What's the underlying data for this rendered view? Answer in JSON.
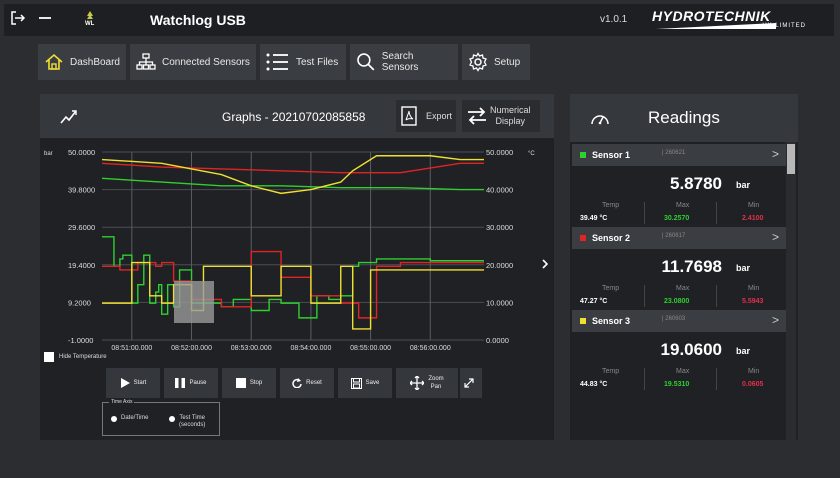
{
  "app": {
    "title": "Watchlog USB",
    "version": "v1.0.1",
    "brand": "HYDROTECHNIK",
    "brand_sub": "UK LIMITED",
    "logo_text": "WL"
  },
  "nav": [
    {
      "label": "DashBoard",
      "icon": "home-icon"
    },
    {
      "label": "Connected Sensors",
      "icon": "network-icon"
    },
    {
      "label": "Test Files",
      "icon": "list-icon"
    },
    {
      "label": "Search Sensors",
      "icon": "search-icon"
    },
    {
      "label": "Setup",
      "icon": "gear-icon"
    }
  ],
  "graph": {
    "title": "Graphs - 20210702085858",
    "export_label": "Export",
    "numerical_label_1": "Numerical",
    "numerical_label_2": "Display",
    "hide_temperature_label": "Hide Temperature",
    "left_unit": "bar",
    "right_unit": "°C",
    "controls": {
      "start": "Start",
      "pause": "Pause",
      "stop": "Stop",
      "reset": "Reset",
      "save": "Save",
      "zoom_1": "Zoom",
      "zoom_2": "Pan"
    },
    "time_axis": {
      "title": "Time Axis",
      "option1": "Date/Time",
      "option2_1": "Test Time",
      "option2_2": "(seconds)"
    }
  },
  "chart_data": {
    "type": "line",
    "ylabel": "bar",
    "y2label": "°C",
    "ylim": [
      -1.0,
      50.0
    ],
    "y2lim": [
      0,
      50
    ],
    "yticks": [
      "50.0000",
      "39.8000",
      "29.6000",
      "19.4000",
      "9.2000",
      "-1.0000"
    ],
    "y2ticks": [
      "50.0000",
      "40.0000",
      "30.0000",
      "20.0000",
      "10.0000",
      "0.0000"
    ],
    "xticks": [
      "08:51:00.000",
      "08:52:00.000",
      "08:53:00.000",
      "08:54:00.000",
      "08:55:00.000",
      "08:56:00.000"
    ],
    "grid": true,
    "series": [
      {
        "name": "Sensor 1",
        "color": "#2fd02f",
        "axis": "pressure",
        "x": [
          0,
          0.2,
          0.3,
          0.35,
          0.5,
          0.6,
          0.7,
          0.8,
          0.9,
          0.95,
          1.0,
          1.1,
          1.2,
          1.3,
          1.5,
          2.0,
          2.2,
          2.5,
          2.8,
          3.0,
          3.3,
          3.6,
          3.8,
          4.0,
          4.2,
          4.3,
          4.6,
          5.0,
          5.5,
          6.0,
          6.4
        ],
        "values": [
          27,
          19,
          21,
          22,
          9,
          14,
          22,
          9,
          12,
          14,
          6,
          14,
          8,
          18,
          9,
          8,
          10,
          7,
          10,
          9,
          5,
          11,
          10,
          11,
          19,
          20,
          21,
          21,
          20.5,
          20.5,
          20.5
        ]
      },
      {
        "name": "Sensor 2",
        "color": "#e02424",
        "axis": "pressure",
        "x": [
          0,
          0.3,
          0.6,
          0.9,
          1.0,
          1.2,
          1.5,
          2.0,
          2.5,
          3.0,
          3.5,
          4.0,
          4.3,
          4.6,
          5.0,
          6.0,
          6.4
        ],
        "values": [
          19,
          18,
          20,
          19,
          20,
          15,
          10,
          8,
          23,
          16,
          11,
          9,
          5,
          19,
          20,
          20,
          20
        ]
      },
      {
        "name": "Sensor 3",
        "color": "#f0e030",
        "axis": "pressure",
        "x": [
          0,
          0.5,
          0.8,
          1.0,
          1.2,
          1.5,
          1.7,
          2.0,
          2.5,
          3.0,
          3.5,
          4.0,
          4.2,
          4.5,
          5.0,
          5.5,
          6.0,
          6.4
        ],
        "values": [
          9,
          20,
          11,
          9,
          14,
          7,
          19,
          19,
          11,
          19,
          9,
          19,
          2,
          18,
          18,
          18,
          18,
          18
        ]
      },
      {
        "name": "Sensor 1 Temp",
        "color": "#2fd02f",
        "axis": "temperature",
        "x": [
          0,
          1,
          2,
          3,
          4,
          5,
          6,
          6.4
        ],
        "y": [
          43,
          42,
          41,
          41,
          40.5,
          40.5,
          40,
          40
        ]
      },
      {
        "name": "Sensor 2 Temp",
        "color": "#e02424",
        "axis": "temperature",
        "x": [
          0,
          1,
          2,
          3,
          4,
          5,
          6,
          6.4
        ],
        "y": [
          47,
          46,
          45.5,
          45,
          44.5,
          44.5,
          47,
          47
        ]
      },
      {
        "name": "Sensor 3 Temp",
        "color": "#f0e030",
        "axis": "temperature",
        "x": [
          0,
          1,
          2,
          2.5,
          3,
          3.5,
          4,
          4.2,
          4.6,
          5,
          5.5,
          6,
          6.4
        ],
        "y": [
          48,
          47,
          44,
          41,
          39,
          40,
          42,
          45,
          49,
          49,
          49,
          48,
          48
        ]
      }
    ]
  },
  "readings": {
    "title": "Readings",
    "temp_label": "Temp",
    "max_label": "Max",
    "min_label": "Min",
    "temp_unit": "°C",
    "sensors": [
      {
        "name": "Sensor 1",
        "id": "260621",
        "color": "#2fd02f",
        "value": "5.8780",
        "unit": "bar",
        "temp": "39.49",
        "max": "30.2570",
        "min": "2.4100"
      },
      {
        "name": "Sensor 2",
        "id": "260617",
        "color": "#e02424",
        "value": "11.7698",
        "unit": "bar",
        "temp": "47.27",
        "max": "23.0800",
        "min": "5.5943"
      },
      {
        "name": "Sensor 3",
        "id": "260603",
        "color": "#f0e030",
        "value": "19.0600",
        "unit": "bar",
        "temp": "44.83",
        "max": "19.5310",
        "min": "0.0605"
      }
    ]
  },
  "colors": {
    "max": "#2fd02f",
    "min": "#e0304a"
  }
}
